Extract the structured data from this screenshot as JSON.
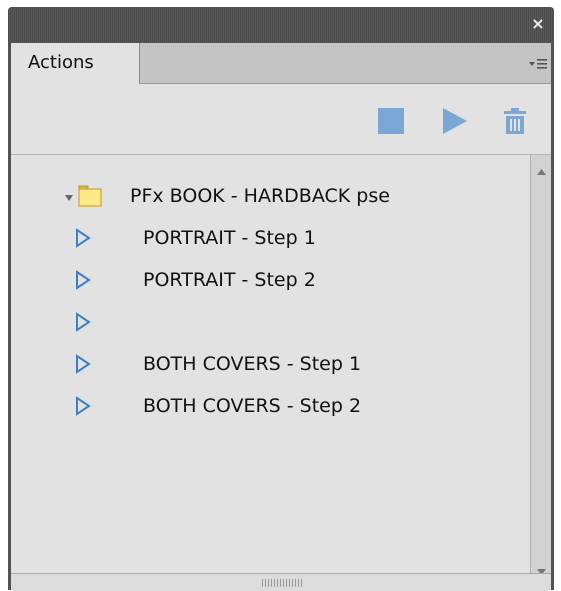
{
  "window": {
    "close_glyph": "×"
  },
  "tabs": [
    {
      "label": "Actions",
      "active": true
    }
  ],
  "toolbar": {
    "buttons": [
      "stop-recording",
      "play-action",
      "delete-action"
    ],
    "icon_color": "#7aa7d6"
  },
  "actions": {
    "set": {
      "label": "PFx BOOK - HARDBACK pse",
      "expanded": true
    },
    "items": [
      {
        "label": "PORTRAIT - Step 1"
      },
      {
        "label": "PORTRAIT - Step 2"
      },
      {
        "label": ""
      },
      {
        "label": "BOTH COVERS - Step 1"
      },
      {
        "label": "BOTH COVERS - Step 2"
      }
    ]
  },
  "colors": {
    "panel_bg": "#e2e2e2",
    "folder_fill": "#fde98a",
    "play_icon": "#3d7fc8"
  }
}
